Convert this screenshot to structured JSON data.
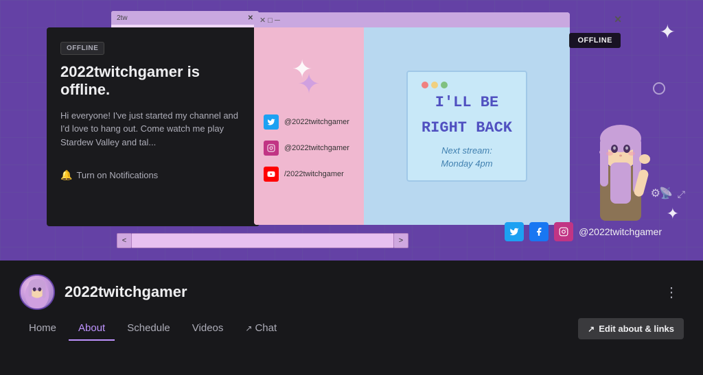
{
  "banner": {
    "offline_badge": "OFFLINE",
    "offline_panel": {
      "badge": "OFFLINE",
      "title": "2022twitchgamer is offline.",
      "description": "Hi everyone! I've just started my channel and I'd love to hang out. Come watch me play Stardew Valley and tal...",
      "notif_button": "Turn on Notifications"
    },
    "rightback": {
      "line1": "I'LL BE",
      "line2": "RIGHT BACK",
      "next_stream_label": "Next stream:",
      "next_stream_value": "Monday 4pm"
    },
    "social_links": [
      {
        "platform": "twitter",
        "handle": "@2022twitchgamer"
      },
      {
        "platform": "instagram",
        "handle": "@2022twitchgamer"
      },
      {
        "platform": "youtube",
        "handle": "/2022twitchgamer"
      }
    ],
    "banner_social": {
      "username": "@2022twitchgamer"
    },
    "top_window_label": "2tw"
  },
  "profile": {
    "username": "2022twitchgamer",
    "more_icon": "⋮"
  },
  "nav": {
    "tabs": [
      {
        "id": "home",
        "label": "Home",
        "active": false
      },
      {
        "id": "about",
        "label": "About",
        "active": true
      },
      {
        "id": "schedule",
        "label": "Schedule",
        "active": false
      },
      {
        "id": "videos",
        "label": "Videos",
        "active": false
      },
      {
        "id": "chat",
        "label": "Chat",
        "active": false,
        "external": true
      }
    ],
    "edit_button": "Edit about & links",
    "edit_icon": "↗"
  }
}
